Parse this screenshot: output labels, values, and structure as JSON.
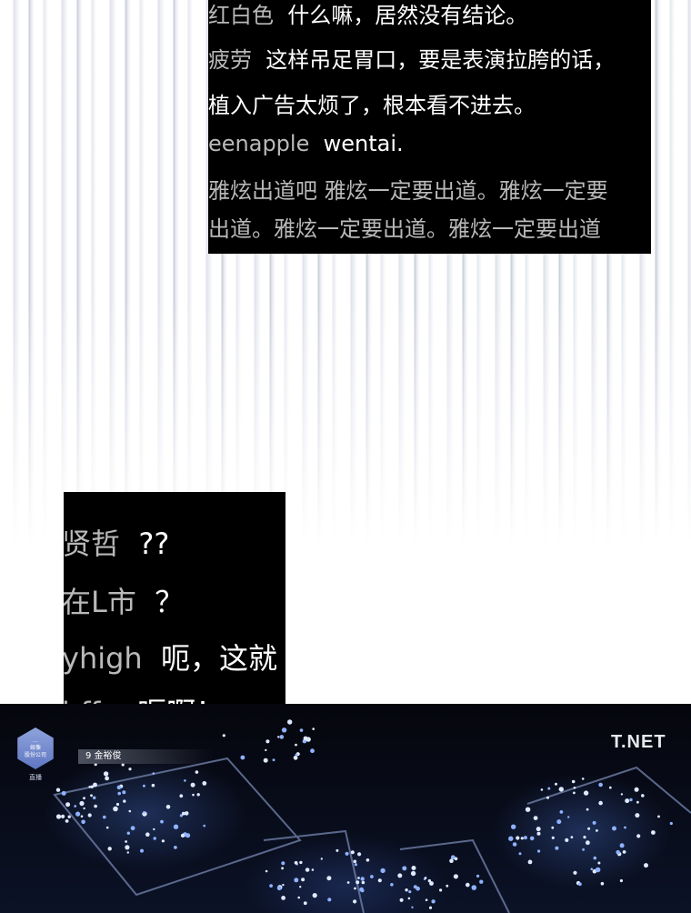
{
  "top_chat": [
    {
      "user": "红白色",
      "message": "什么嘛，居然没有结论。"
    },
    {
      "user": "疲劳",
      "message": "这样吊足胃口，要是表演拉胯的话，"
    },
    {
      "user": "",
      "message": "植入广告太烦了，根本看不进去。"
    },
    {
      "user": "eenapple",
      "message": "wentai."
    },
    {
      "user": "",
      "message": "雅炫出道吧 雅炫一定要出道。雅炫一定要"
    },
    {
      "user": "",
      "message": "出道。雅炫一定要出道。雅炫一定要出道"
    }
  ],
  "mid_chat": [
    {
      "user": "贤哲",
      "message": "??"
    },
    {
      "user": "在L市",
      "message": "？"
    },
    {
      "user": "yhigh",
      "message": "呃，这就"
    },
    {
      "user": "hffu",
      "message": "呃啊！"
    }
  ],
  "broadcast": {
    "badge_line1": "...",
    "badge_line2": "娱像",
    "badge_line3": "股份公司",
    "badge_live": "直播",
    "name_tag": "9 金裕俊",
    "logo": "T.NET"
  }
}
